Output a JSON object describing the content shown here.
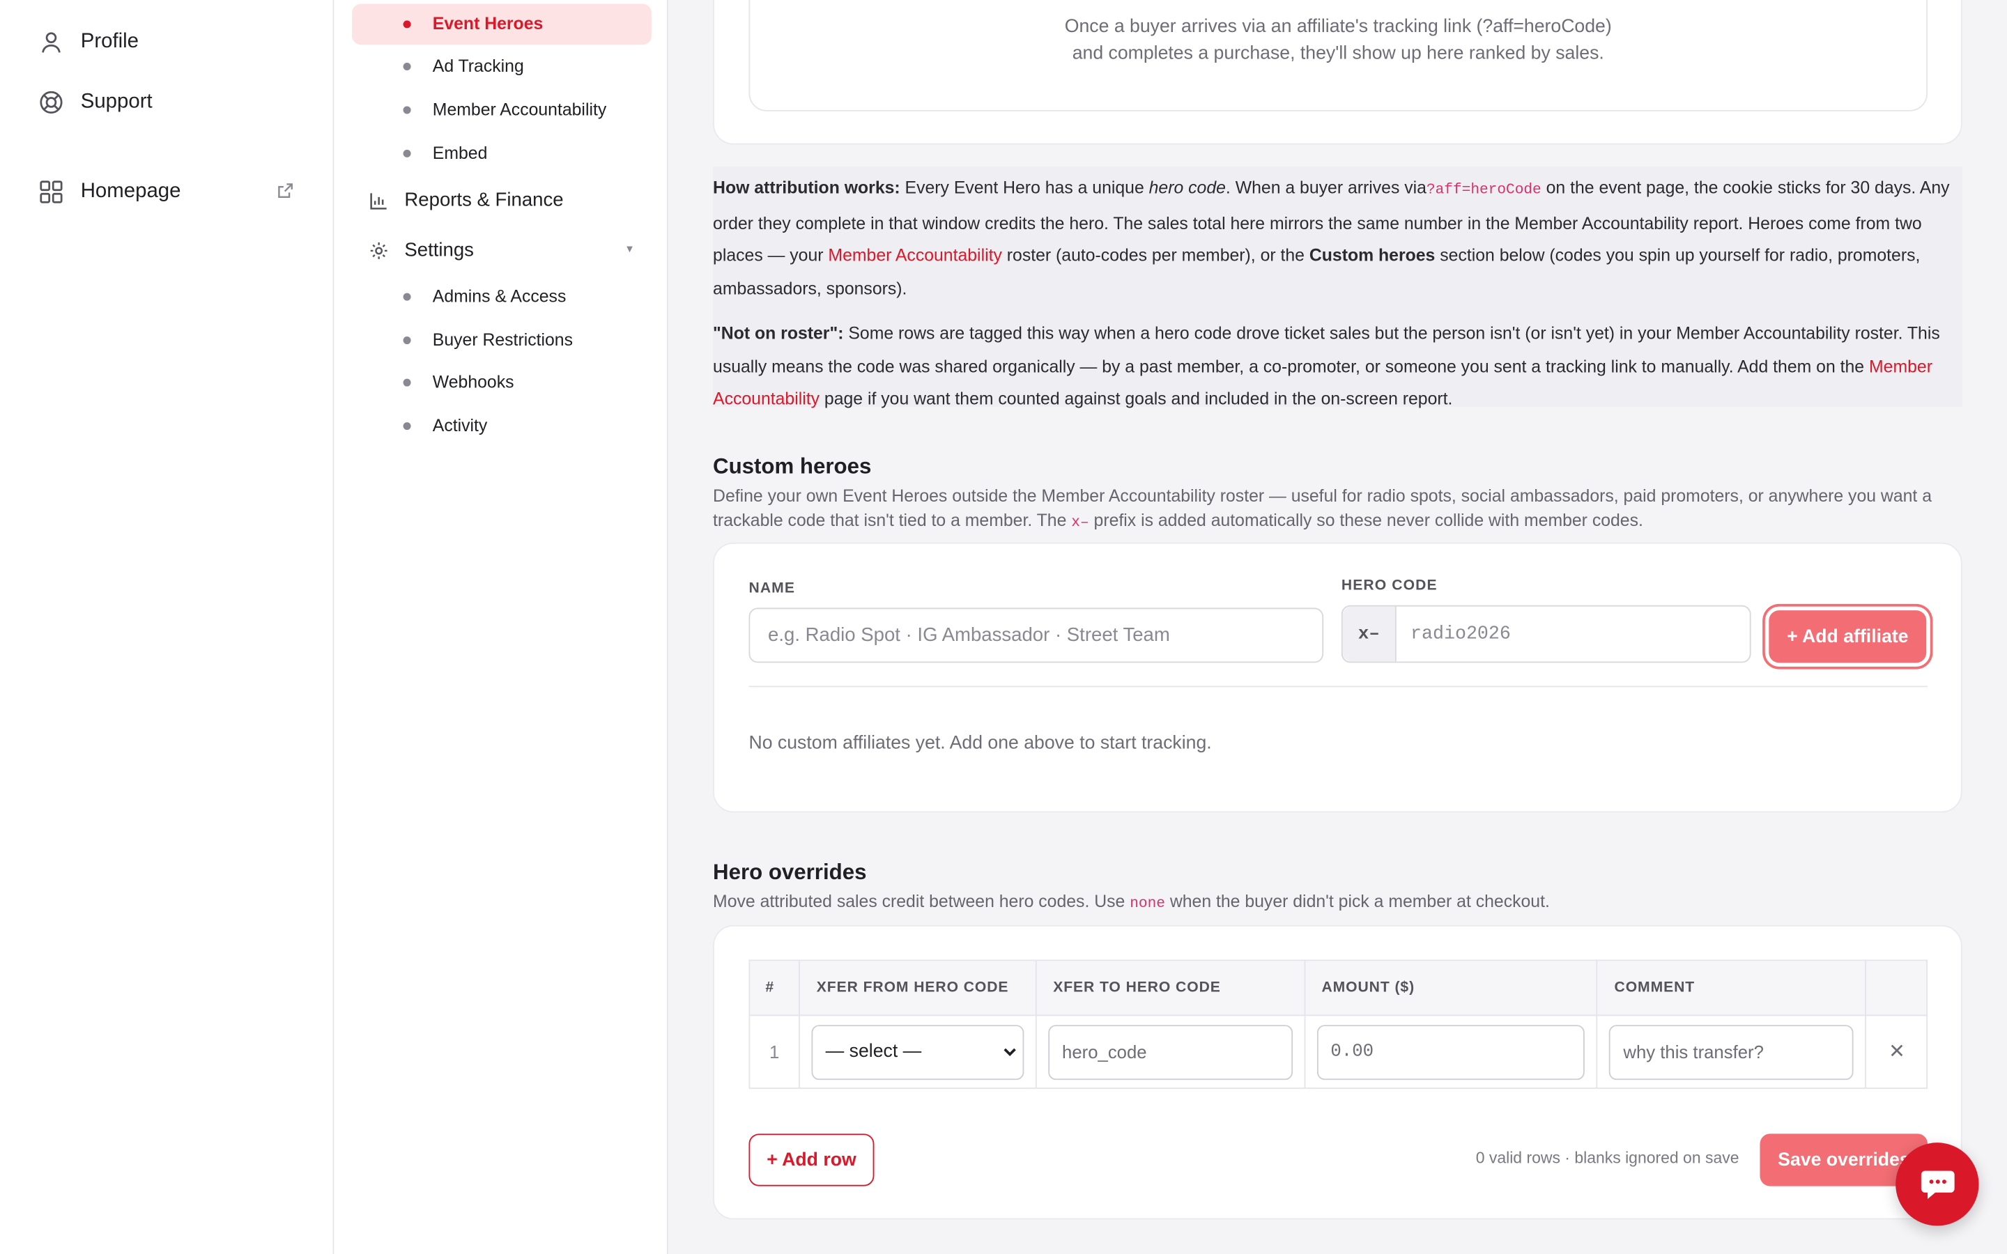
{
  "rail": {
    "profile": "Profile",
    "support": "Support",
    "homepage": "Homepage"
  },
  "subnav": {
    "event_heroes": "Event Heroes",
    "ad_tracking": "Ad Tracking",
    "member_accountability": "Member Accountability",
    "embed": "Embed",
    "reports_finance": "Reports & Finance",
    "settings": "Settings",
    "admins_access": "Admins & Access",
    "buyer_restrictions": "Buyer Restrictions",
    "webhooks": "Webhooks",
    "activity": "Activity"
  },
  "empty_leaderboard": {
    "line1": "Once a buyer arrives via an affiliate's tracking link (?aff=heroCode)",
    "line2": "and completes a purchase, they'll show up here ranked by sales."
  },
  "info": {
    "p1_bold": "How attribution works:",
    "p1_a": " Every Event Hero has a unique ",
    "p1_em": "hero code",
    "p1_b": ". When a buyer arrives via",
    "p1_code": "?aff=heroCode",
    "p1_c": " on the event page, the cookie sticks for 30 days. Any order they complete in that window credits the hero. The sales total here mirrors the same number in the Member Accountability report. Heroes come from two places — your ",
    "p1_link": "Member Accountability",
    "p1_d": " roster (auto-codes per member), or the ",
    "p1_bold2": "Custom heroes",
    "p1_e": " section below (codes you spin up yourself for radio, promoters, ambassadors, sponsors).",
    "p2_bold": "\"Not on roster\":",
    "p2_a": " Some rows are tagged this way when a hero code drove ticket sales but the person isn't (or isn't yet) in your Member Accountability roster. This usually means the code was shared organically — by a past member, a co-promoter, or someone you sent a tracking link to manually. Add them on the ",
    "p2_link": "Member Accountability",
    "p2_b": " page if you want them counted against goals and included in the on-screen report."
  },
  "custom": {
    "title": "Custom heroes",
    "desc_a": "Define your own Event Heroes outside the Member Accountability roster — useful for radio spots, social ambassadors, paid promoters, or anywhere you want a trackable code that isn't tied to a member. The ",
    "desc_code": "x–",
    "desc_b": " prefix is added automatically so these never collide with member codes.",
    "name_label": "NAME",
    "name_placeholder": "e.g. Radio Spot · IG Ambassador · Street Team",
    "code_label": "HERO CODE",
    "code_prefix": "x–",
    "code_placeholder": "radio2026",
    "add_button": "+ Add affiliate",
    "empty": "No custom affiliates yet. Add one above to start tracking."
  },
  "overrides": {
    "title": "Hero overrides",
    "desc_a": "Move attributed sales credit between hero codes. Use ",
    "desc_code": "none",
    "desc_b": " when the buyer didn't pick a member at checkout.",
    "headers": [
      "#",
      "XFER FROM HERO CODE",
      "XFER TO HERO CODE",
      "AMOUNT ($)",
      "COMMENT"
    ],
    "row": {
      "num": "1",
      "from": "— select —",
      "to_placeholder": "hero_code",
      "amount_placeholder": "0.00",
      "comment_placeholder": "why this transfer?"
    },
    "add_row": "+ Add row",
    "status": "0 valid rows · blanks ignored on save",
    "save": "Save overrides"
  },
  "colors": {
    "accent": "#d9182a",
    "accent_soft": "#f26d74",
    "active_bg": "#fde3e4"
  }
}
